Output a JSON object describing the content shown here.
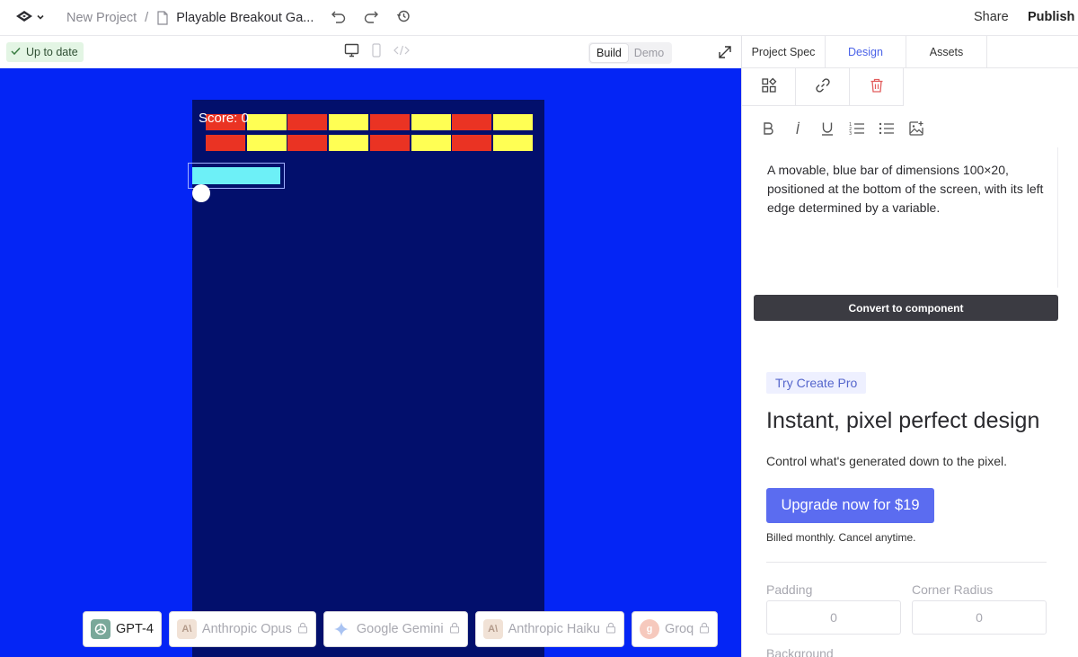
{
  "header": {
    "project": "New Project",
    "separator": "/",
    "file": "Playable Breakout Ga...",
    "share": "Share",
    "publish": "Publish",
    "icons": [
      "logo-icon",
      "chevron-down-icon",
      "document-icon",
      "undo-icon",
      "redo-icon",
      "history-icon"
    ]
  },
  "toolbar": {
    "status": "Up to date",
    "modes": {
      "build": "Build",
      "demo": "Demo"
    },
    "icons": [
      "check-icon",
      "desktop-icon",
      "mobile-icon",
      "code-icon",
      "expand-icon"
    ]
  },
  "game": {
    "score": "Score: 0",
    "colors": {
      "background": "#020f6c",
      "canvas": "#0425f5",
      "red": "#ea3323",
      "yellow": "#ffff54",
      "paddle": "#6df0f7",
      "ball": "#ffffff"
    },
    "brick_rows": [
      [
        "red",
        "yellow",
        "red",
        "yellow",
        "red",
        "yellow",
        "red",
        "yellow"
      ],
      [
        "red",
        "yellow",
        "red",
        "yellow",
        "red",
        "yellow",
        "red",
        "yellow"
      ]
    ]
  },
  "models": [
    {
      "label": "GPT-4",
      "icon": "openai-icon",
      "locked": false
    },
    {
      "label": "Anthropic Opus",
      "icon": "anthropic-icon",
      "locked": true
    },
    {
      "label": "Google Gemini",
      "icon": "gemini-icon",
      "locked": true
    },
    {
      "label": "Anthropic Haiku",
      "icon": "anthropic-icon",
      "locked": true
    },
    {
      "label": "Groq",
      "icon": "groq-icon",
      "locked": true
    }
  ],
  "panel": {
    "tabs": [
      "Project Spec",
      "Design",
      "Assets"
    ],
    "selected_tab": "Design",
    "tools": [
      "components-icon",
      "link-icon",
      "trash-icon"
    ],
    "format_buttons": [
      "bold-icon",
      "italic-icon",
      "underline-icon",
      "ordered-list-icon",
      "bullet-list-icon",
      "image-add-icon"
    ],
    "description": "A movable, blue bar of dimensions 100×20, positioned at the bottom of the screen, with its left edge determined by a variable.",
    "convert_button": "Convert to component",
    "pro": {
      "badge": "Try Create Pro",
      "title": "Instant, pixel perfect design",
      "description": "Control what's generated down to the pixel.",
      "upgrade_button": "Upgrade now for $19",
      "billing_note": "Billed monthly. Cancel anytime."
    },
    "properties": {
      "padding_label": "Padding",
      "padding_value": "0",
      "corner_radius_label": "Corner Radius",
      "corner_radius_value": "0",
      "background_label": "Background"
    },
    "accent": "#5b6cf0"
  }
}
